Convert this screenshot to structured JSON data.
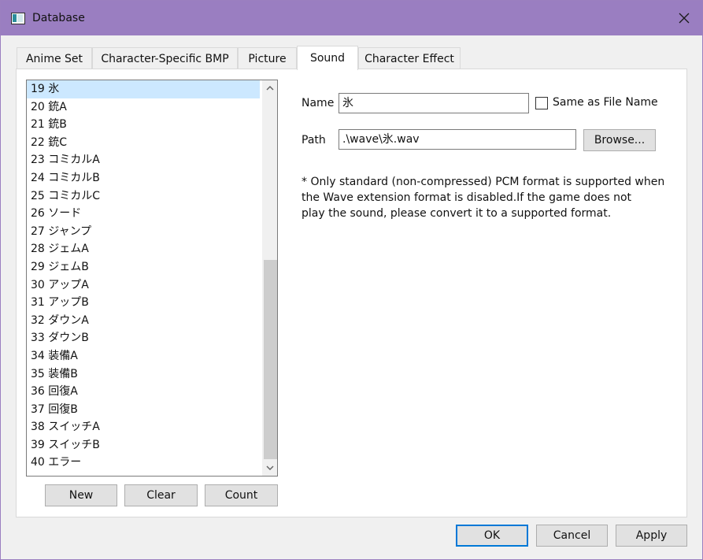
{
  "window": {
    "title": "Database",
    "close_icon": "close-icon",
    "app_icon": "database-app-icon"
  },
  "tabs": [
    {
      "label": "Anime Set",
      "active": false
    },
    {
      "label": "Character-Specific BMP",
      "active": false
    },
    {
      "label": "Picture",
      "active": false
    },
    {
      "label": "Sound",
      "active": true
    },
    {
      "label": "Character Effect",
      "active": false
    }
  ],
  "sound_list": {
    "items": [
      "19 氷",
      "20 銃A",
      "21 銃B",
      "22 銃C",
      "23 コミカルA",
      "24 コミカルB",
      "25 コミカルC",
      "26 ソード",
      "27 ジャンプ",
      "28 ジェムA",
      "29 ジェムB",
      "30 アップA",
      "31 アップB",
      "32 ダウンA",
      "33 ダウンB",
      "34 装備A",
      "35 装備B",
      "36 回復A",
      "37 回復B",
      "38 スイッチA",
      "39 スイッチB",
      "40 エラー"
    ],
    "selected_index": 0,
    "scroll_up_icon": "chevron-up-icon",
    "scroll_down_icon": "chevron-down-icon"
  },
  "list_buttons": {
    "new": "New",
    "clear": "Clear",
    "count": "Count"
  },
  "form": {
    "name_label": "Name",
    "name_value": "氷",
    "same_as_file_label": "Same as File Name",
    "same_as_file_checked": false,
    "path_label": "Path",
    "path_value": ".\\wave\\氷.wav",
    "browse_label": "Browse..."
  },
  "note": {
    "line1": "* Only standard (non-compressed) PCM format is supported when",
    "line2": "the Wave extension format is disabled.If the game does not",
    "line3": "play the sound, please convert it to a supported format."
  },
  "dialog_buttons": {
    "ok": "OK",
    "cancel": "Cancel",
    "apply": "Apply"
  },
  "colors": {
    "titlebar": "#9a7ec1",
    "selection": "#cce8ff",
    "default_button_border": "#0078d7"
  }
}
